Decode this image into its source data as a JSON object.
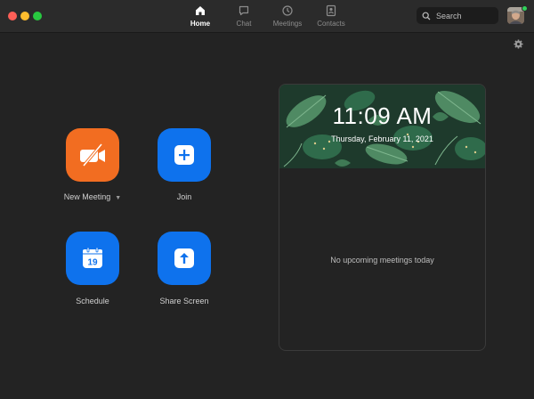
{
  "window": {
    "controls": [
      "close",
      "minimize",
      "zoom"
    ]
  },
  "nav": {
    "tabs": [
      {
        "label": "Home",
        "icon": "home-icon",
        "active": true
      },
      {
        "label": "Chat",
        "icon": "chat-icon",
        "active": false
      },
      {
        "label": "Meetings",
        "icon": "clock-icon",
        "active": false
      },
      {
        "label": "Contacts",
        "icon": "contacts-icon",
        "active": false
      }
    ]
  },
  "search": {
    "label": "Search"
  },
  "user": {
    "status_color": "#2fd15a"
  },
  "actions": {
    "new_meeting": {
      "label": "New Meeting",
      "icon": "video-off-icon",
      "color": "#f26d21"
    },
    "join": {
      "label": "Join",
      "icon": "plus-icon",
      "color": "#0e72ed"
    },
    "schedule": {
      "label": "Schedule",
      "icon": "calendar-icon",
      "day": "19",
      "color": "#0e72ed"
    },
    "share_screen": {
      "label": "Share Screen",
      "icon": "share-arrow-icon",
      "color": "#0e72ed"
    }
  },
  "calendar_card": {
    "time": "11:09 AM",
    "date": "Thursday, February 11, 2021",
    "empty_message": "No upcoming meetings today"
  }
}
